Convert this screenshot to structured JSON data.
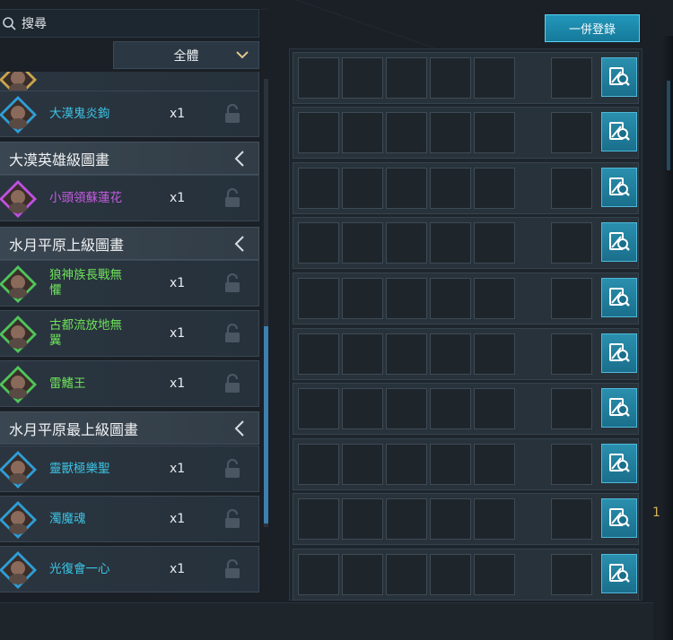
{
  "search": {
    "placeholder": "搜尋"
  },
  "filter": {
    "selected": "全體"
  },
  "register_button": {
    "label": "一併登錄"
  },
  "list": [
    {
      "kind": "item",
      "name": "",
      "count": "",
      "color": "blue",
      "partial": true
    },
    {
      "kind": "item",
      "name": "大漠鬼炎鉤",
      "count": "x1",
      "color": "blue"
    },
    {
      "kind": "header",
      "label": "大漠英雄級圖畫"
    },
    {
      "kind": "item",
      "name": "小頭領蘇蓮花",
      "count": "x1",
      "color": "purple"
    },
    {
      "kind": "header",
      "label": "水月平原上級圖畫"
    },
    {
      "kind": "item",
      "name": "狼神族長戰無懼",
      "count": "x1",
      "color": "green"
    },
    {
      "kind": "item",
      "name": "古都流放地無翼",
      "count": "x1",
      "color": "green"
    },
    {
      "kind": "item",
      "name": "雷鰭王",
      "count": "x1",
      "color": "green"
    },
    {
      "kind": "header",
      "label": "水月平原最上級圖畫"
    },
    {
      "kind": "item",
      "name": "靈獸極樂聖",
      "count": "x1",
      "color": "blue"
    },
    {
      "kind": "item",
      "name": "濁魔魂",
      "count": "x1",
      "color": "blue"
    },
    {
      "kind": "item",
      "name": "光復會一心",
      "count": "x1",
      "color": "blue"
    }
  ],
  "grid": {
    "rows": 10,
    "slots_per_row": 6
  },
  "edge_mark": "1",
  "colors": {
    "accent": "#2197bb",
    "blue_name": "#3cc4e4",
    "purple_name": "#c55ce0",
    "green_name": "#6ee05a"
  }
}
